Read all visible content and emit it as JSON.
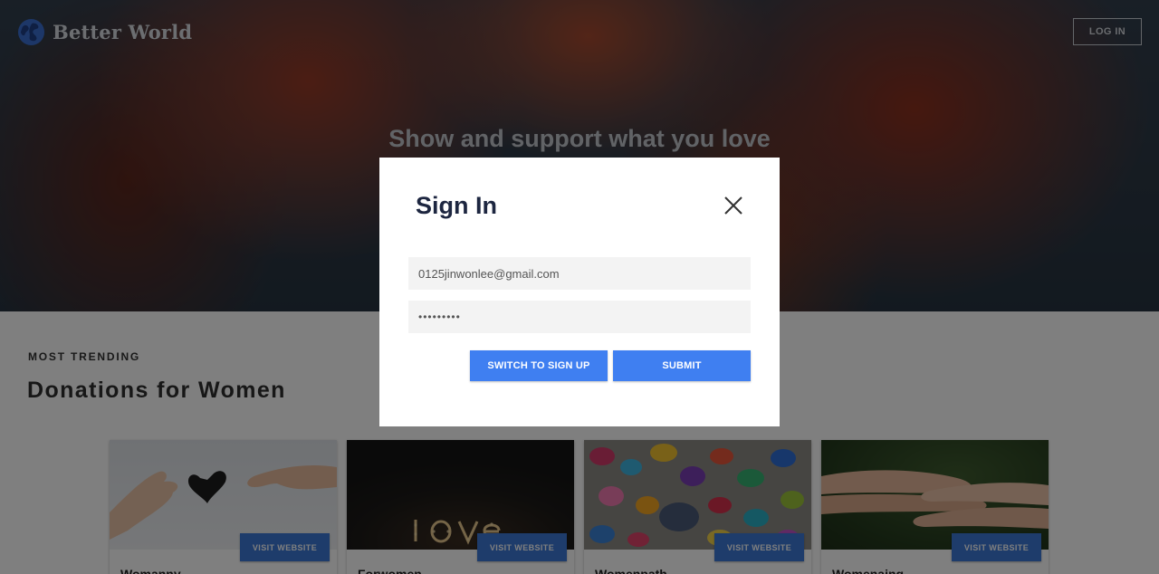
{
  "header": {
    "brand_name": "Better World",
    "login_label": "LOG IN"
  },
  "hero": {
    "title": "Show and support what you love"
  },
  "trending": {
    "eyebrow": "MOST TRENDING",
    "title": "Donations for Women",
    "cards": [
      {
        "title": "Womanny",
        "button": "VISIT WEBSITE",
        "image": "hands-heart-image"
      },
      {
        "title": "Forwomen",
        "button": "VISIT WEBSITE",
        "image": "love-lights-image"
      },
      {
        "title": "Womenpath",
        "button": "VISIT WEBSITE",
        "image": "painted-rocks-image"
      },
      {
        "title": "Womenaing",
        "button": "VISIT WEBSITE",
        "image": "stacked-hands-image"
      }
    ]
  },
  "modal": {
    "title": "Sign In",
    "email_value": "0125jinwonlee@gmail.com",
    "password_value": "•••••••••",
    "switch_label": "SWITCH TO SIGN UP",
    "submit_label": "SUBMIT"
  },
  "colors": {
    "accent": "#3f7ff1",
    "card_button": "#3d78d6",
    "modal_title": "#1d2640"
  }
}
